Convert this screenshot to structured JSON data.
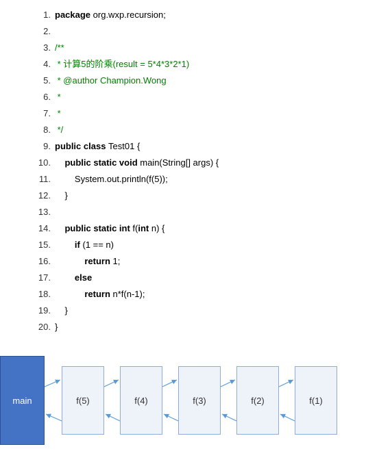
{
  "code": {
    "lines": [
      {
        "n": "1.",
        "indent": 0,
        "tokens": [
          {
            "t": "package ",
            "c": "kw"
          },
          {
            "t": "org.wxp.recursion;",
            "c": "plain"
          }
        ]
      },
      {
        "n": "2.",
        "indent": 0,
        "tokens": []
      },
      {
        "n": "3.",
        "indent": 0,
        "tokens": [
          {
            "t": "/**",
            "c": "comment"
          }
        ]
      },
      {
        "n": "4.",
        "indent": 0,
        "tokens": [
          {
            "t": " * 计算5的阶乘(result = 5*4*3*2*1)",
            "c": "comment"
          }
        ]
      },
      {
        "n": "5.",
        "indent": 0,
        "tokens": [
          {
            "t": " * @author Champion.Wong",
            "c": "comment"
          }
        ]
      },
      {
        "n": "6.",
        "indent": 0,
        "tokens": [
          {
            "t": " *",
            "c": "comment"
          }
        ]
      },
      {
        "n": "7.",
        "indent": 0,
        "tokens": [
          {
            "t": " *",
            "c": "comment"
          }
        ]
      },
      {
        "n": "8.",
        "indent": 0,
        "tokens": [
          {
            "t": " */",
            "c": "comment"
          }
        ]
      },
      {
        "n": "9.",
        "indent": 0,
        "tokens": [
          {
            "t": "public class ",
            "c": "kw"
          },
          {
            "t": "Test01 {",
            "c": "plain"
          }
        ]
      },
      {
        "n": "10.",
        "indent": 1,
        "tokens": [
          {
            "t": "public static void ",
            "c": "kw"
          },
          {
            "t": "main(String[] args) {",
            "c": "plain"
          }
        ]
      },
      {
        "n": "11.",
        "indent": 2,
        "tokens": [
          {
            "t": "System.out.println(f(5));",
            "c": "plain"
          }
        ]
      },
      {
        "n": "12.",
        "indent": 1,
        "tokens": [
          {
            "t": "}",
            "c": "plain"
          }
        ]
      },
      {
        "n": "13.",
        "indent": 0,
        "tokens": []
      },
      {
        "n": "14.",
        "indent": 1,
        "tokens": [
          {
            "t": "public static int ",
            "c": "kw"
          },
          {
            "t": "f(",
            "c": "plain"
          },
          {
            "t": "int ",
            "c": "kw"
          },
          {
            "t": "n) {",
            "c": "plain"
          }
        ]
      },
      {
        "n": "15.",
        "indent": 2,
        "tokens": [
          {
            "t": "if ",
            "c": "kw"
          },
          {
            "t": "(1 == n)",
            "c": "plain"
          }
        ]
      },
      {
        "n": "16.",
        "indent": 3,
        "tokens": [
          {
            "t": "return ",
            "c": "kw"
          },
          {
            "t": "1;",
            "c": "plain"
          }
        ]
      },
      {
        "n": "17.",
        "indent": 2,
        "tokens": [
          {
            "t": "else",
            "c": "kw"
          }
        ]
      },
      {
        "n": "18.",
        "indent": 3,
        "tokens": [
          {
            "t": "return ",
            "c": "kw"
          },
          {
            "t": "n*f(n-1);",
            "c": "plain"
          }
        ]
      },
      {
        "n": "19.",
        "indent": 1,
        "tokens": [
          {
            "t": "}",
            "c": "plain"
          }
        ]
      },
      {
        "n": "20.",
        "indent": 0,
        "tokens": [
          {
            "t": "}",
            "c": "plain"
          }
        ]
      }
    ]
  },
  "diagram": {
    "main": "main",
    "boxes": [
      "f(5)",
      "f(4)",
      "f(3)",
      "f(2)",
      "f(1)"
    ]
  }
}
